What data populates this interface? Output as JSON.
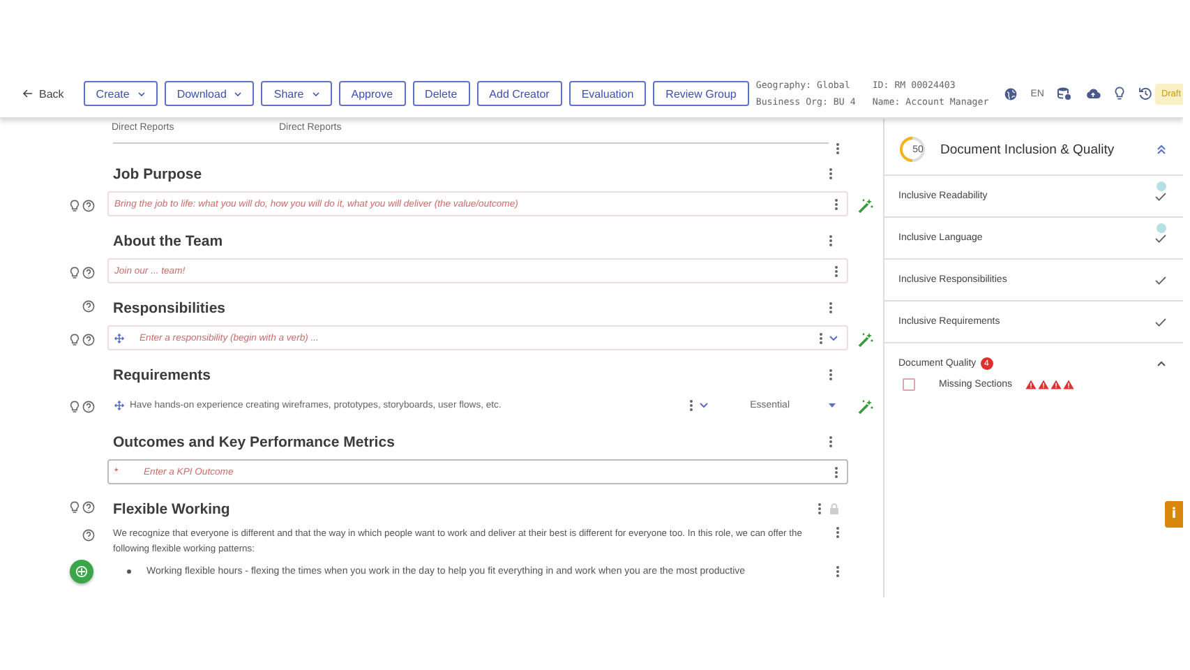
{
  "toolbar": {
    "back": "Back",
    "buttons": [
      {
        "label": "Create",
        "dropdown": true
      },
      {
        "label": "Download",
        "dropdown": true
      },
      {
        "label": "Share",
        "dropdown": true
      },
      {
        "label": "Approve",
        "dropdown": false
      },
      {
        "label": "Delete",
        "dropdown": false
      },
      {
        "label": "Add Creator",
        "dropdown": false
      },
      {
        "label": "Evaluation",
        "dropdown": false
      },
      {
        "label": "Review Group",
        "dropdown": false
      }
    ],
    "info": [
      {
        "lines": [
          "Geography: Global",
          "Business Org: BU 4"
        ]
      },
      {
        "lines": [
          "ID: RM 00024403",
          "Name: Account Manager"
        ]
      }
    ],
    "language": "EN",
    "status": "Draft"
  },
  "document": {
    "rows": [
      {
        "kind": "columns",
        "texts": [
          "Direct Reports",
          "Direct Reports"
        ]
      },
      {
        "kind": "divider"
      },
      {
        "kind": "heading",
        "text": "Job Purpose",
        "tips": false,
        "help": false,
        "locked": false
      },
      {
        "kind": "field",
        "placeholder": "Bring the job to life: what you will do, how you will do it, what you will deliver (the value/outcome)",
        "tips": true,
        "help": true,
        "ai_assist": true
      },
      {
        "kind": "heading",
        "text": "About the Team",
        "tips": false,
        "help": false,
        "locked": false
      },
      {
        "kind": "field",
        "placeholder": "Join our ... team!",
        "tips": true,
        "help": true,
        "ai_assist": false
      },
      {
        "kind": "heading",
        "text": "Responsibilities",
        "tips": false,
        "help": true,
        "locked": false
      },
      {
        "kind": "list_field",
        "placeholder": "Enter a responsibility (begin with a verb) ...",
        "tips": true,
        "help": true,
        "ai_assist": true
      },
      {
        "kind": "heading",
        "text": "Requirements",
        "tips": false,
        "help": false,
        "locked": false
      },
      {
        "kind": "list_item",
        "value": "Have hands-on experience creating wireframes, prototypes, storyboards, user flows, etc.",
        "priority": "Essential",
        "tips": true,
        "help": true,
        "ai_assist": true
      },
      {
        "kind": "heading",
        "text": "Outcomes and Key Performance Metrics",
        "tips": false,
        "help": false,
        "locked": false
      },
      {
        "kind": "required_field",
        "marker": "*",
        "placeholder": "Enter a KPI Outcome",
        "tips": false,
        "help": false,
        "ai_assist": false
      },
      {
        "kind": "heading",
        "text": "Flexible Working",
        "tips": true,
        "help": true,
        "locked": true
      },
      {
        "kind": "paragraph",
        "text": "We recognize that everyone is different and that the way in which people want to work and deliver at their best is different for everyone too. In this role, we can offer the following flexible working patterns:",
        "help": true
      },
      {
        "kind": "bullet",
        "text": "Working flexible hours - flexing the times when you work in the day to help you fit everything in and work when you are the most productive",
        "assistant": true
      }
    ]
  },
  "quality_panel": {
    "score": "50",
    "level": 0.5,
    "title": "Document Inclusion & Quality",
    "expanded": true,
    "checks": [
      {
        "label": "Inclusive Readability",
        "passed": true,
        "note": true
      },
      {
        "label": "Inclusive Language",
        "passed": true,
        "note": true
      },
      {
        "label": "Inclusive Responsibilities",
        "passed": true,
        "note": false
      },
      {
        "label": "Inclusive Requirements",
        "passed": true,
        "note": false
      }
    ],
    "document_quality": {
      "label": "Document Quality",
      "badge": "4",
      "expanded": true,
      "items": [
        {
          "label": "Missing Sections",
          "checked": false,
          "warnings": [
            {
              "kind": "triangle"
            },
            {
              "kind": "triangle"
            },
            {
              "kind": "triangle"
            },
            {
              "kind": "triangle"
            }
          ]
        }
      ]
    }
  },
  "info_tab": "i"
}
